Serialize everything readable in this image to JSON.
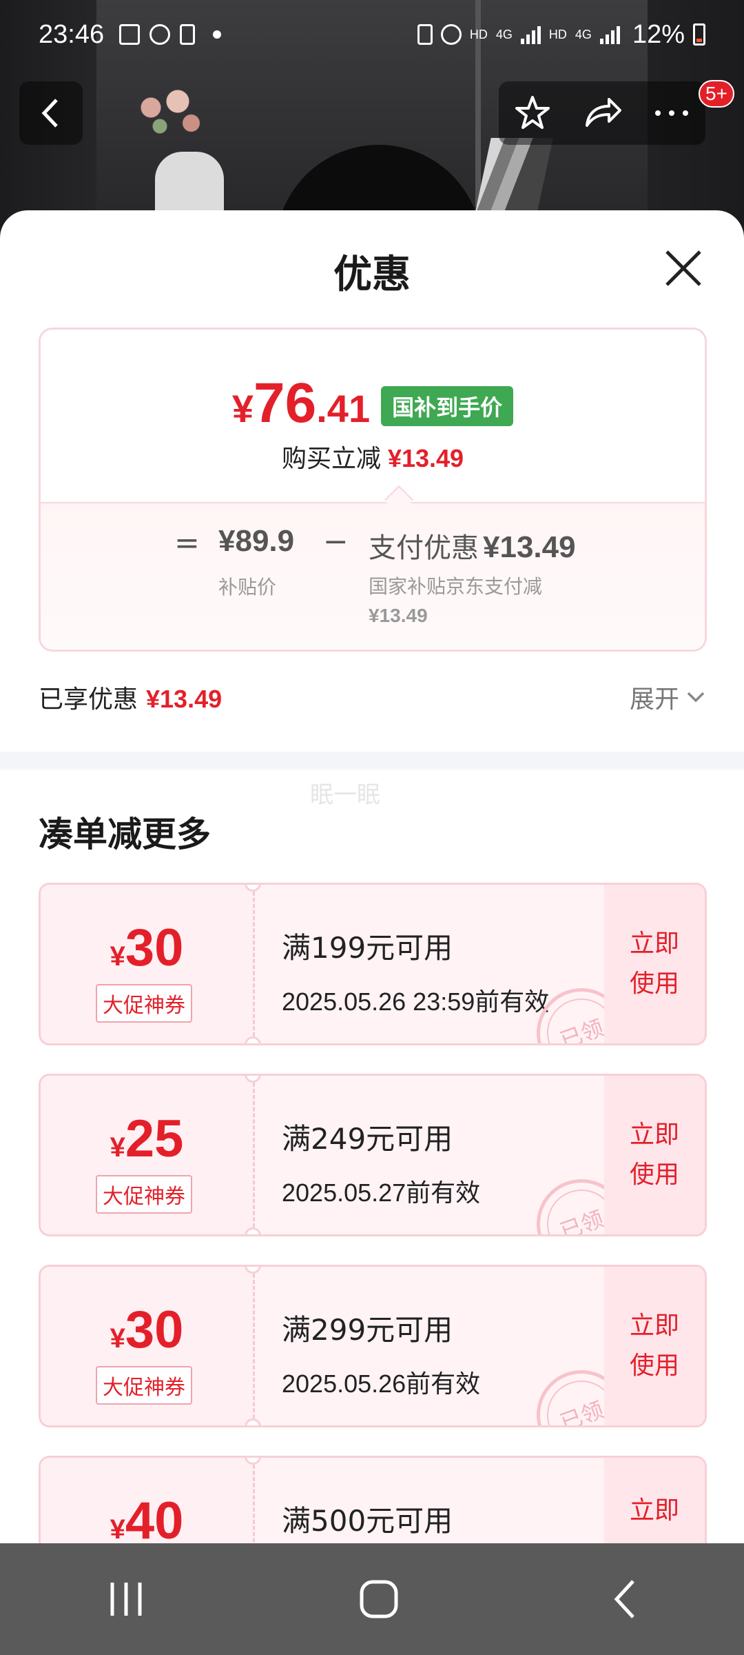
{
  "status_bar": {
    "time": "23:46",
    "network_1": "HD",
    "network_2": "4G",
    "network_3": "HD",
    "network_4": "4G",
    "battery": "12%"
  },
  "top_nav": {
    "badge": "5+"
  },
  "sheet": {
    "title": "优惠"
  },
  "price_card": {
    "yen": "¥",
    "price_int": "76",
    "price_dec": ".41",
    "price_tag": "国补到手价",
    "sub_label": "购买立减",
    "sub_value": "¥13.49",
    "eq": "=",
    "subsidy_value": "¥89.9",
    "subsidy_label": "补贴价",
    "minus": "−",
    "pay_label": "支付优惠",
    "pay_value": "¥13.49",
    "pay_desc": "国家补贴京东支付减",
    "pay_desc_value": "¥13.49"
  },
  "enjoyed": {
    "label": "已享优惠",
    "value": "¥13.49",
    "expand": "展开"
  },
  "watermark": "眠一眠",
  "section_title": "凑单减更多",
  "coupons": [
    {
      "yen": "¥",
      "amount": "30",
      "tag": "大促神券",
      "condition": "满199元可用",
      "validity": "2025.05.26 23:59前有效",
      "use_line1": "立即",
      "use_line2": "使用",
      "stamp": "已领"
    },
    {
      "yen": "¥",
      "amount": "25",
      "tag": "大促神券",
      "condition": "满249元可用",
      "validity": "2025.05.27前有效",
      "use_line1": "立即",
      "use_line2": "使用",
      "stamp": "已领"
    },
    {
      "yen": "¥",
      "amount": "30",
      "tag": "大促神券",
      "condition": "满299元可用",
      "validity": "2025.05.26前有效",
      "use_line1": "立即",
      "use_line2": "使用",
      "stamp": "已领"
    },
    {
      "yen": "¥",
      "amount": "40",
      "tag": "",
      "condition": "满500元可用",
      "validity": "",
      "use_line1": "立即",
      "use_line2": "",
      "stamp": ""
    }
  ],
  "colors": {
    "accent_red": "#e3202a",
    "tag_green": "#3fa852",
    "coupon_bg": "#fff3f5"
  }
}
